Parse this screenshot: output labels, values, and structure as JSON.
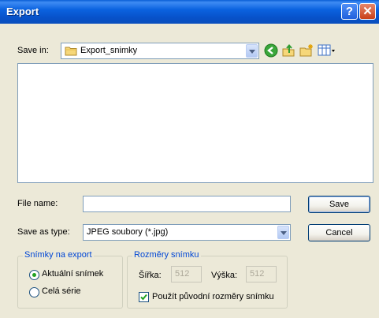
{
  "window": {
    "title": "Export"
  },
  "toolbar": {
    "save_in_label": "Save in:",
    "save_in_value": "Export_snimky"
  },
  "form": {
    "file_name_label": "File name:",
    "file_name_value": "",
    "save_as_type_label": "Save as type:",
    "save_as_type_value": "JPEG soubory (*.jpg)",
    "save_button": "Save",
    "cancel_button": "Cancel"
  },
  "export_group": {
    "legend": "Snímky na export",
    "options": [
      {
        "label": "Aktuální snímek",
        "selected": true
      },
      {
        "label": "Celá série",
        "selected": false
      }
    ]
  },
  "size_group": {
    "legend": "Rozměry snímku",
    "width_label": "Šířka:",
    "width_value": "512",
    "height_label": "Výška:",
    "height_value": "512",
    "original_size_label": "Použít původní rozměry snímku",
    "original_size_checked": true
  },
  "icons": [
    "help-icon",
    "close-icon",
    "folder-icon",
    "back-icon",
    "up-folder-icon",
    "new-folder-icon",
    "view-menu-icon",
    "chevron-down-icon"
  ]
}
